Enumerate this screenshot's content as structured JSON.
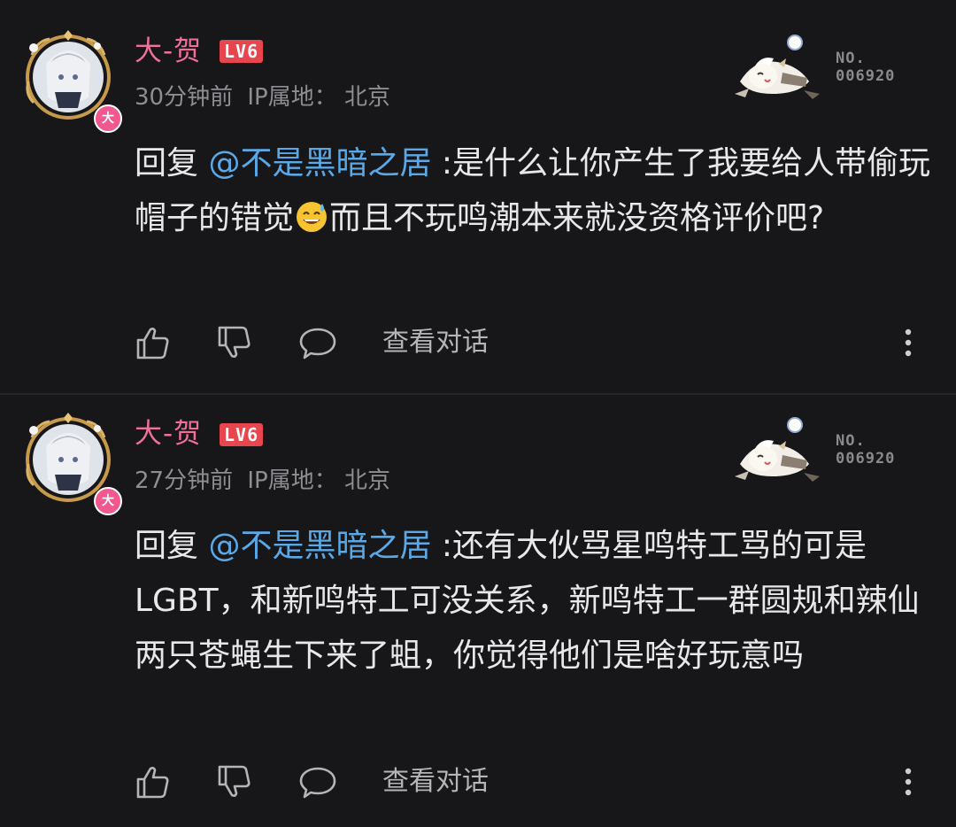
{
  "comments": [
    {
      "username": "大-贺",
      "level": "LV6",
      "avatar_badge": "大",
      "time": "30分钟前",
      "ip_label": "IP属地：",
      "ip_location": "北京",
      "fan_no_label": "NO.",
      "fan_no_value": "006920",
      "reply_prefix": "回复",
      "mention": "@不是黑暗之居",
      "text_part1": " :是什么让你产生了我要给人带偷玩帽子的错觉",
      "emoji_name": "sweat-smile-emoji",
      "text_part2": "而且不玩鸣潮本来就没资格评价吧?",
      "view_conversation": "查看对话",
      "icons": [
        "like-icon",
        "dislike-icon",
        "reply-icon",
        "more-icon"
      ]
    },
    {
      "username": "大-贺",
      "level": "LV6",
      "avatar_badge": "大",
      "time": "27分钟前",
      "ip_label": "IP属地：",
      "ip_location": "北京",
      "fan_no_label": "NO.",
      "fan_no_value": "006920",
      "reply_prefix": "回复",
      "mention": "@不是黑暗之居",
      "text_part1": " :还有大伙骂星鸣特工骂的可是LGBT，和新鸣特工可没关系，新鸣特工一群圆规和辣仙两只苍蝇生下来了蛆，你觉得他们是啥好玩意吗",
      "view_conversation": "查看对话",
      "icons": [
        "like-icon",
        "dislike-icon",
        "reply-icon",
        "more-icon"
      ]
    }
  ],
  "colors": {
    "background": "#17171a",
    "username": "#f07099",
    "mention": "#5aa9e6",
    "level_badge": "#e8464f",
    "meta_text": "#8d8d92"
  }
}
